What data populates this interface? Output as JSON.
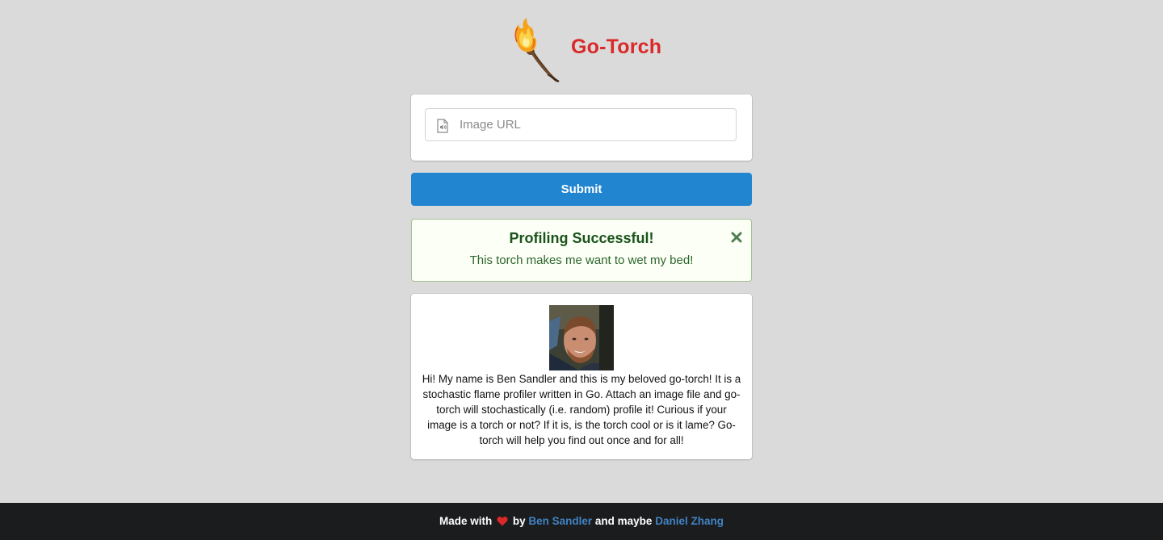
{
  "brand": {
    "title": "Go-Torch",
    "logo_icon": "torch-icon",
    "title_color": "#db2828"
  },
  "form": {
    "url_placeholder": "Image URL",
    "url_value": "",
    "field_icon": "file-audio-icon",
    "submit_label": "Submit",
    "submit_color": "#2185d0"
  },
  "message": {
    "header": "Profiling Successful!",
    "body": "This torch makes me want to wet my bed!",
    "close_icon": "close-icon",
    "background": "#fcfff5",
    "text_color": "#2c662d"
  },
  "about": {
    "avatar_icon": "avatar",
    "text": "Hi! My name is Ben Sandler and this is my beloved go-torch! It is a stochastic flame profiler written in Go. Attach an image file and go-torch will stochastically (i.e. random) profile it! Curious if your image is a torch or not? If it is, is the torch cool or is it lame? Go-torch will help you find out once and for all!"
  },
  "footer": {
    "made_with": "Made with",
    "heart_icon": "heart-icon",
    "by": "by",
    "author1": "Ben Sandler",
    "and_maybe": "and maybe",
    "author2": "Daniel Zhang",
    "background": "#1b1c1d",
    "link_color": "#4183c4"
  }
}
